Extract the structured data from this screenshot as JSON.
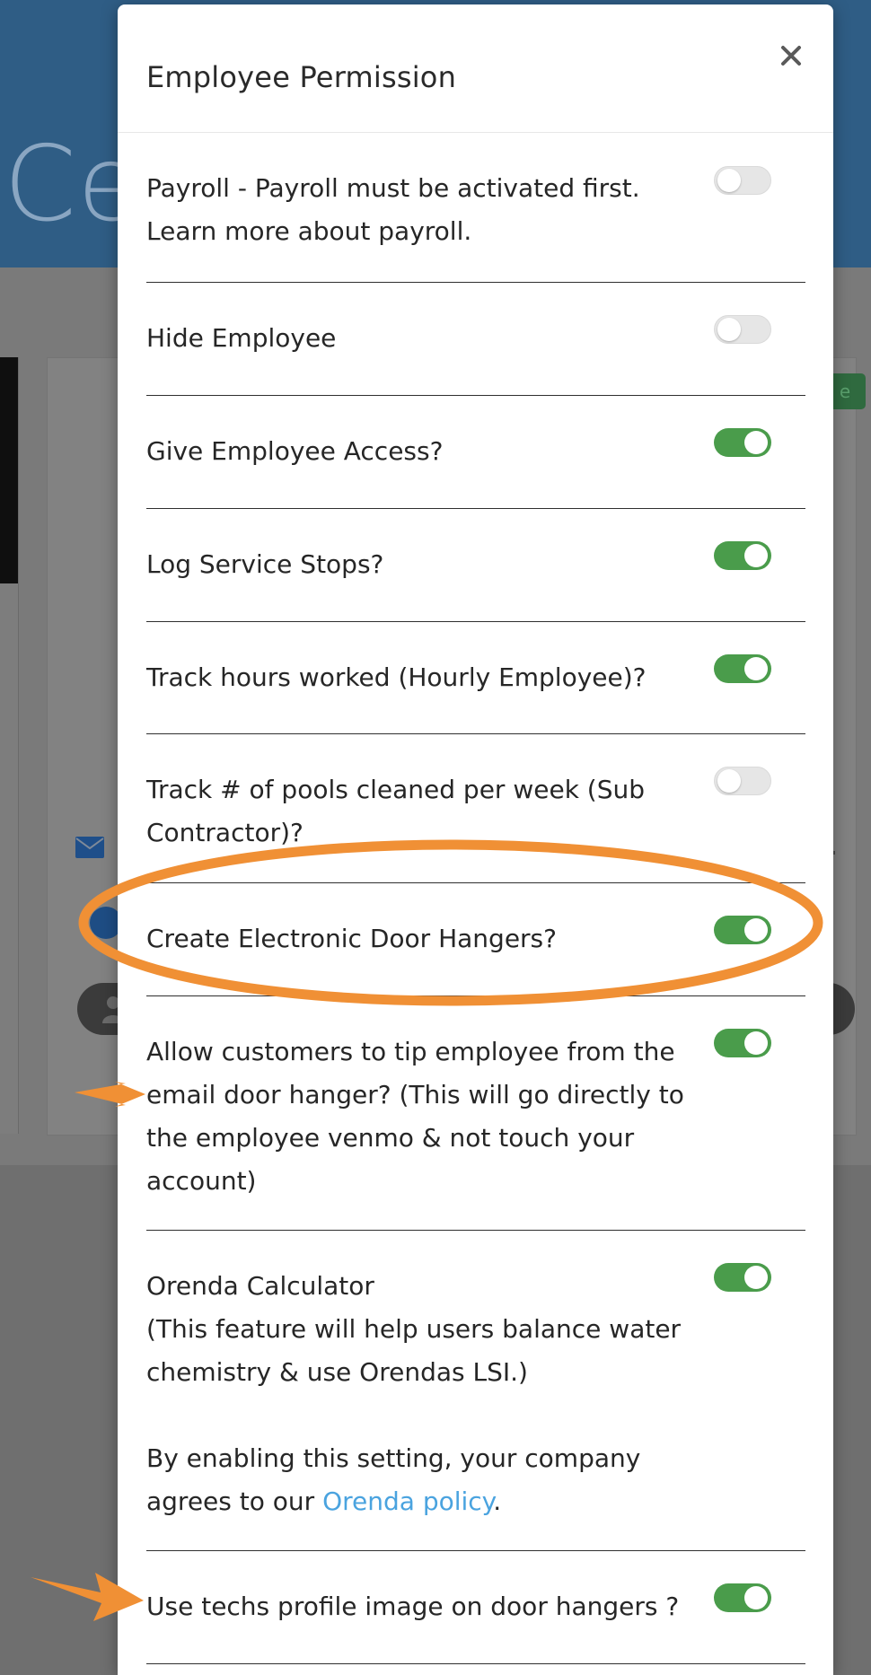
{
  "background": {
    "header_text": "Ce"
  },
  "modal": {
    "title": "Employee Permission",
    "close_glyph": "×",
    "permissions": [
      {
        "label": "Payroll - Payroll must be activated first. Learn more about payroll.",
        "enabled": false
      },
      {
        "label": "Hide Employee",
        "enabled": false
      },
      {
        "label": "Give Employee Access?",
        "enabled": true
      },
      {
        "label": "Log Service Stops?",
        "enabled": true
      },
      {
        "label": "Track hours worked (Hourly Employee)?",
        "enabled": true
      },
      {
        "label": "Track # of pools cleaned per week (Sub Contractor)?",
        "enabled": false
      },
      {
        "label": "Create Electronic Door Hangers?",
        "enabled": true
      },
      {
        "label": "Allow customers to tip employee from the email door hanger? (This will go directly to the employee venmo & not touch your account)",
        "enabled": true
      },
      {
        "label": "Orenda Calculator",
        "description": "(This feature will help users balance water chemistry & use Orendas LSI.)",
        "policy_text_before": "By enabling this setting, your company agrees to our ",
        "policy_link": "Orenda policy",
        "policy_text_after": ".",
        "enabled": true
      },
      {
        "label": "Use techs profile image on door hangers ?",
        "enabled": true
      }
    ]
  },
  "colors": {
    "toggle_on": "#4a9c4b",
    "toggle_off": "#e6e6e6",
    "link": "#4aa3df",
    "annotation": "#f09035"
  },
  "icons": {
    "close": "close-icon",
    "mail": "envelope-icon",
    "user": "user-icon"
  }
}
